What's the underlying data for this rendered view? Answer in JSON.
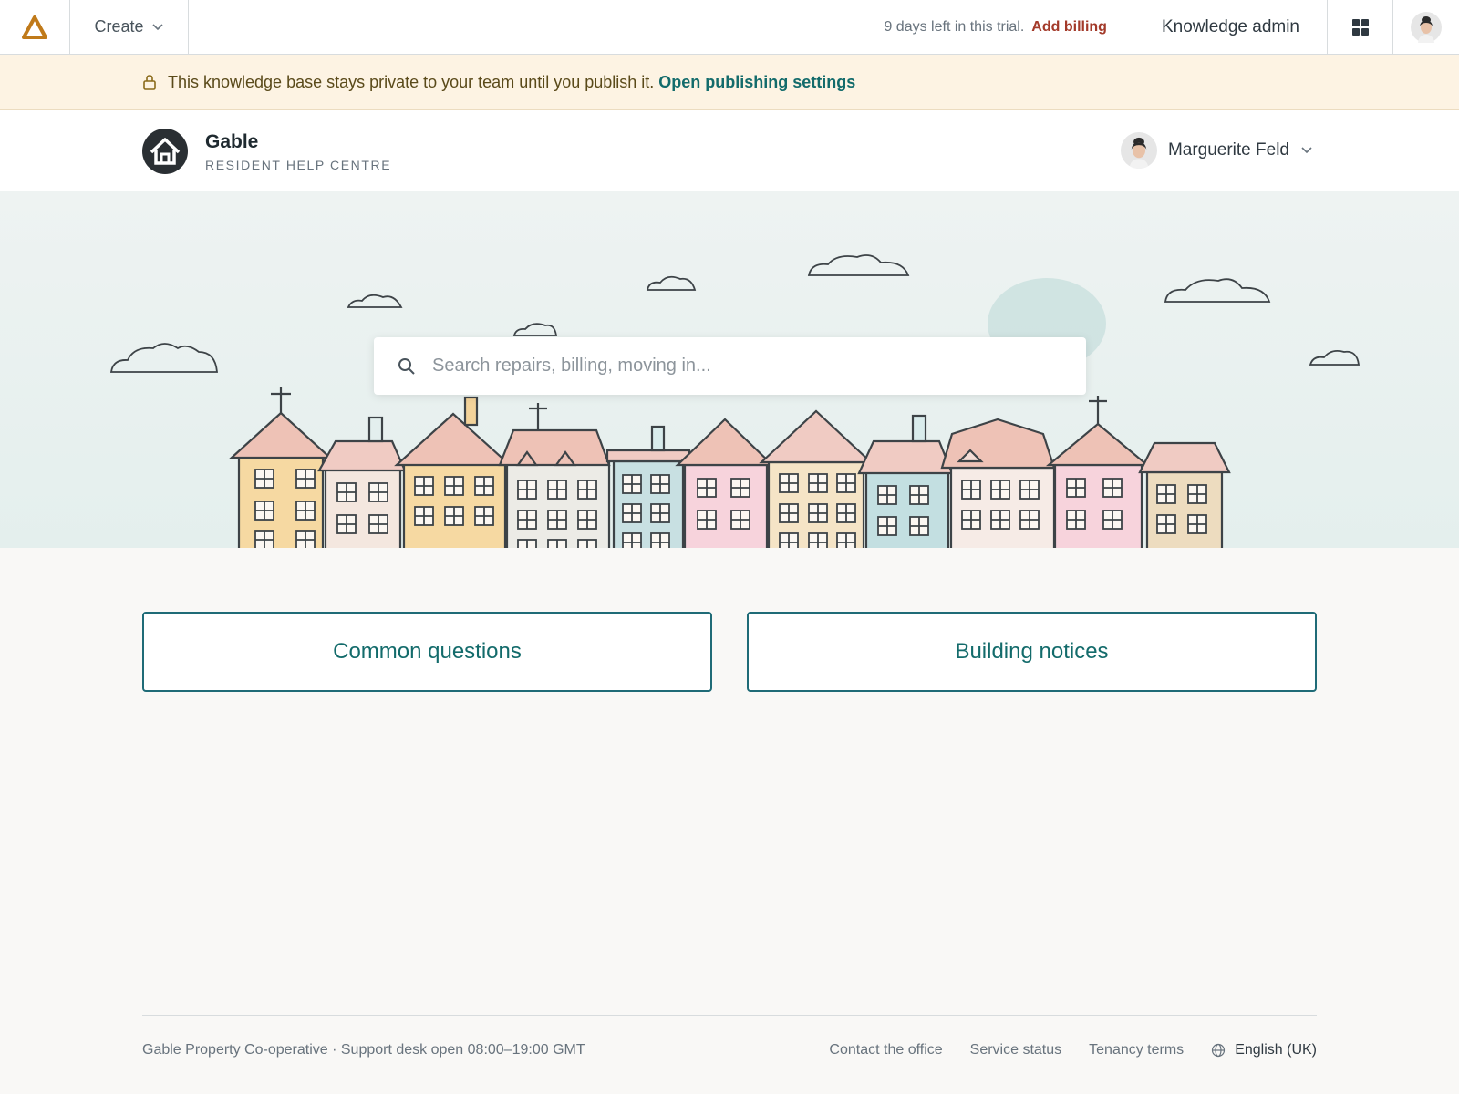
{
  "topbar": {
    "create_label": "Create",
    "trial_text": "9 days left in this trial.",
    "billing_link": "Add billing",
    "admin_label": "Knowledge admin"
  },
  "notice": {
    "text": "This knowledge base stays private to your team until you publish it.",
    "link": "Open publishing settings"
  },
  "brand": {
    "name": "Gable",
    "subtitle": "RESIDENT HELP CENTRE"
  },
  "user": {
    "name": "Marguerite Feld"
  },
  "search": {
    "placeholder": "Search repairs, billing, moving in..."
  },
  "categories": [
    {
      "label": "Common questions"
    },
    {
      "label": "Building notices"
    }
  ],
  "footer": {
    "left_text": "Gable Property Co-operative · Support desk open 08:00–19:00 GMT",
    "links": [
      "Contact the office",
      "Service status",
      "Tenancy terms"
    ],
    "language": "English (UK)"
  },
  "colors": {
    "accent": "#136b6b",
    "billing": "#a33a2a",
    "banner_bg": "#fdf3e3",
    "hero_bg": "#e4efed"
  }
}
